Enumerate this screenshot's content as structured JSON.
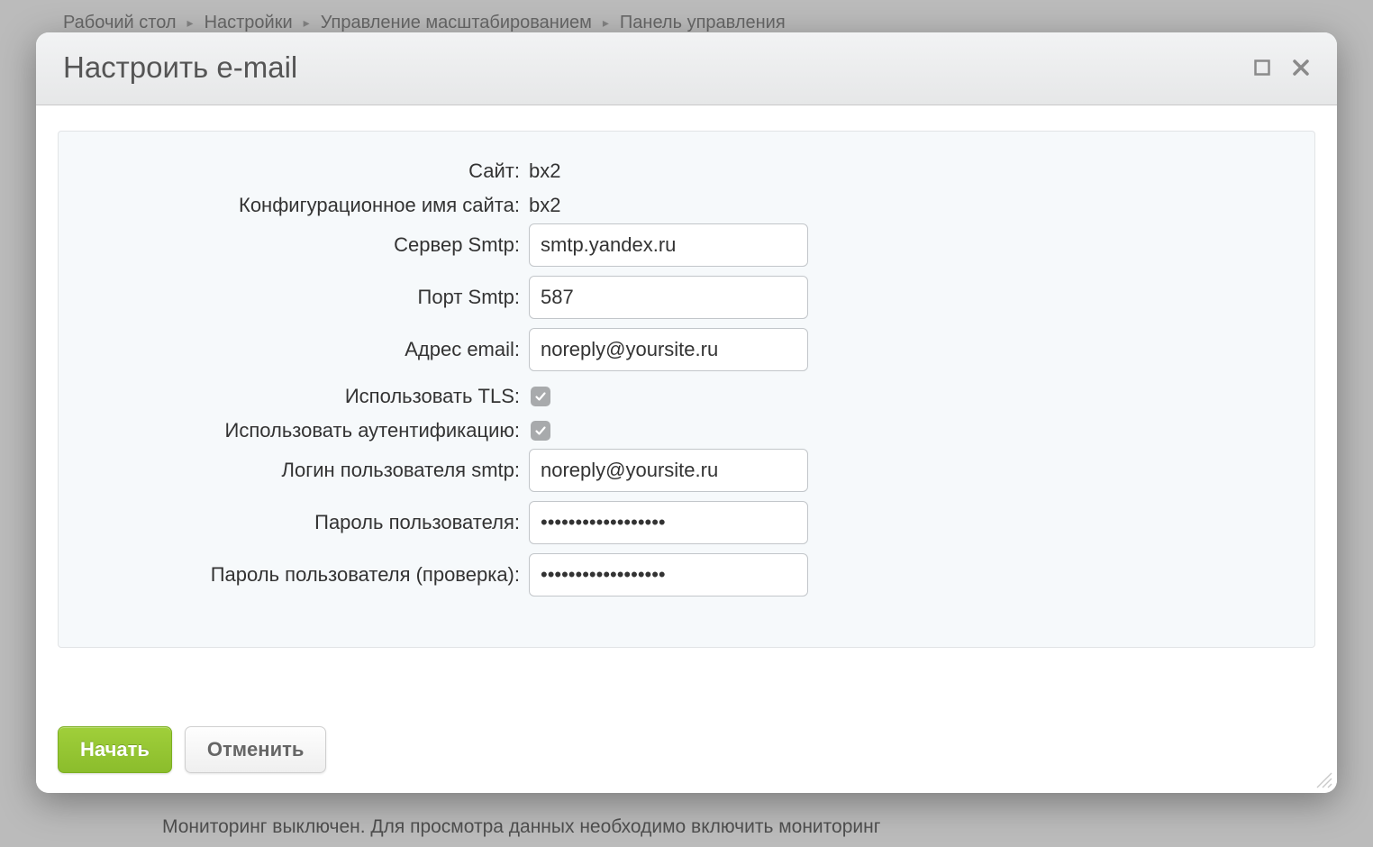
{
  "breadcrumb": {
    "items": [
      "Рабочий стол",
      "Настройки",
      "Управление масштабированием",
      "Панель управления"
    ]
  },
  "backgroundFooter": "Мониторинг выключен. Для просмотра данных необходимо включить мониторинг",
  "modal": {
    "title": "Настроить e-mail",
    "form": {
      "site": {
        "label": "Сайт:",
        "value": "bx2"
      },
      "configName": {
        "label": "Конфигурационное имя сайта:",
        "value": "bx2"
      },
      "smtpServer": {
        "label": "Сервер Smtp:",
        "value": "smtp.yandex.ru"
      },
      "smtpPort": {
        "label": "Порт Smtp:",
        "value": "587"
      },
      "email": {
        "label": "Адрес email:",
        "value": "noreply@yoursite.ru"
      },
      "useTls": {
        "label": "Использовать TLS:",
        "checked": true
      },
      "useAuth": {
        "label": "Использовать аутентификацию:",
        "checked": true
      },
      "smtpLogin": {
        "label": "Логин пользователя smtp:",
        "value": "noreply@yoursite.ru"
      },
      "password": {
        "label": "Пароль пользователя:",
        "value": "••••••••••••••••••"
      },
      "passwordConfirm": {
        "label": "Пароль пользователя (проверка):",
        "value": "••••••••••••••••••"
      }
    },
    "actions": {
      "start": "Начать",
      "cancel": "Отменить"
    }
  }
}
